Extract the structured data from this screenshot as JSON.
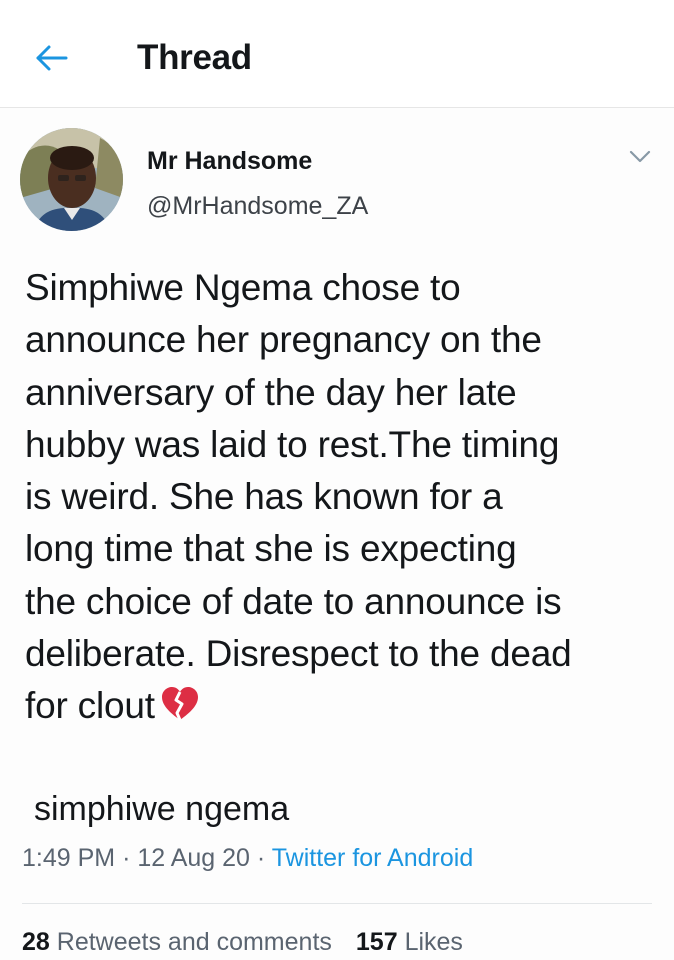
{
  "header": {
    "title": "Thread"
  },
  "tweet": {
    "display_name": "Mr Handsome",
    "handle": "@MrHandsome_ZA",
    "text": "Simphiwe Ngema chose to\nannounce her pregnancy on the\nanniversary of the day her late\nhubby was laid to rest.The timing\nis weird. She has known for a\nlong time that she is expecting\nthe choice of date to announce is\ndeliberate. Disrespect to the dead\nfor clout",
    "emoji": "broken-heart-icon",
    "sub_text": "simphiwe ngema",
    "time": "1:49 PM",
    "date": "12 Aug 20",
    "separator": "·",
    "source": "Twitter for Android",
    "retweets_count": "28",
    "retweets_label": "Retweets and comments",
    "likes_count": "157",
    "likes_label": "Likes"
  },
  "colors": {
    "accent": "#1b95e0",
    "text": "#14171a",
    "muted": "#5a6470",
    "heart": "#e0245e"
  }
}
